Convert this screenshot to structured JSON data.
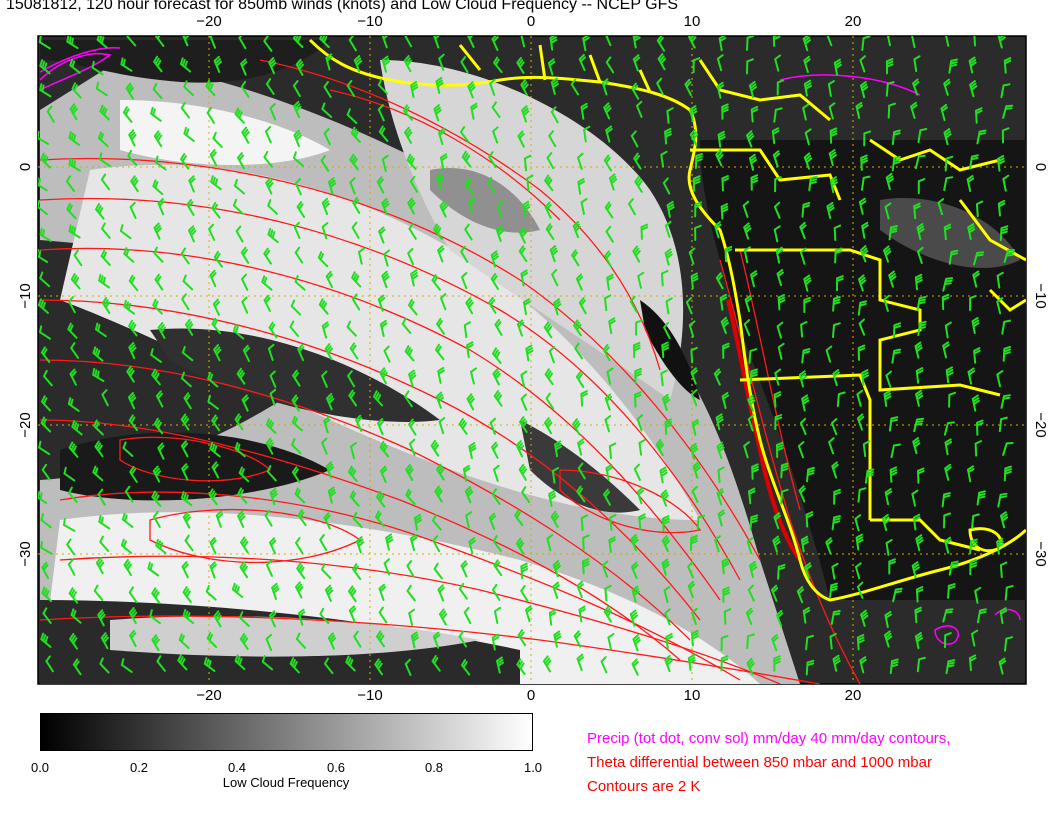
{
  "title": "15081812, 120 hour forecast for 850mb winds (knots) and Low Cloud Frequency -- NCEP GFS",
  "map": {
    "lon_range": [
      -30,
      30
    ],
    "lat_range": [
      -40,
      10
    ],
    "lon_ticks": [
      -20,
      -10,
      0,
      10,
      20
    ],
    "lat_ticks": [
      0,
      -10,
      -20,
      -30
    ],
    "lon_tick_labels": [
      "−20",
      "−10",
      "0",
      "10",
      "20"
    ],
    "lat_tick_labels": [
      "0",
      "−10",
      "−20",
      "−30"
    ],
    "gridlines": true,
    "colors": {
      "wind_barbs": "#22dd22",
      "theta_contours": "#ff0000",
      "precip_contours": "#ff00ff",
      "coastlines_borders": "#ffff00",
      "grid": "#ffd700"
    }
  },
  "colorbar": {
    "label": "Low Cloud Frequency",
    "ticks": [
      "0.0",
      "0.2",
      "0.4",
      "0.6",
      "0.8",
      "1.0"
    ],
    "range": [
      0,
      1
    ],
    "colors": [
      "#000000",
      "#ffffff"
    ]
  },
  "legend": {
    "precip": "Precip (tot dot, conv sol) mm/day 40 mm/day contours,",
    "theta": "Theta differential between 850 mbar and 1000 mbar",
    "contours": "Contours are 2 K"
  }
}
